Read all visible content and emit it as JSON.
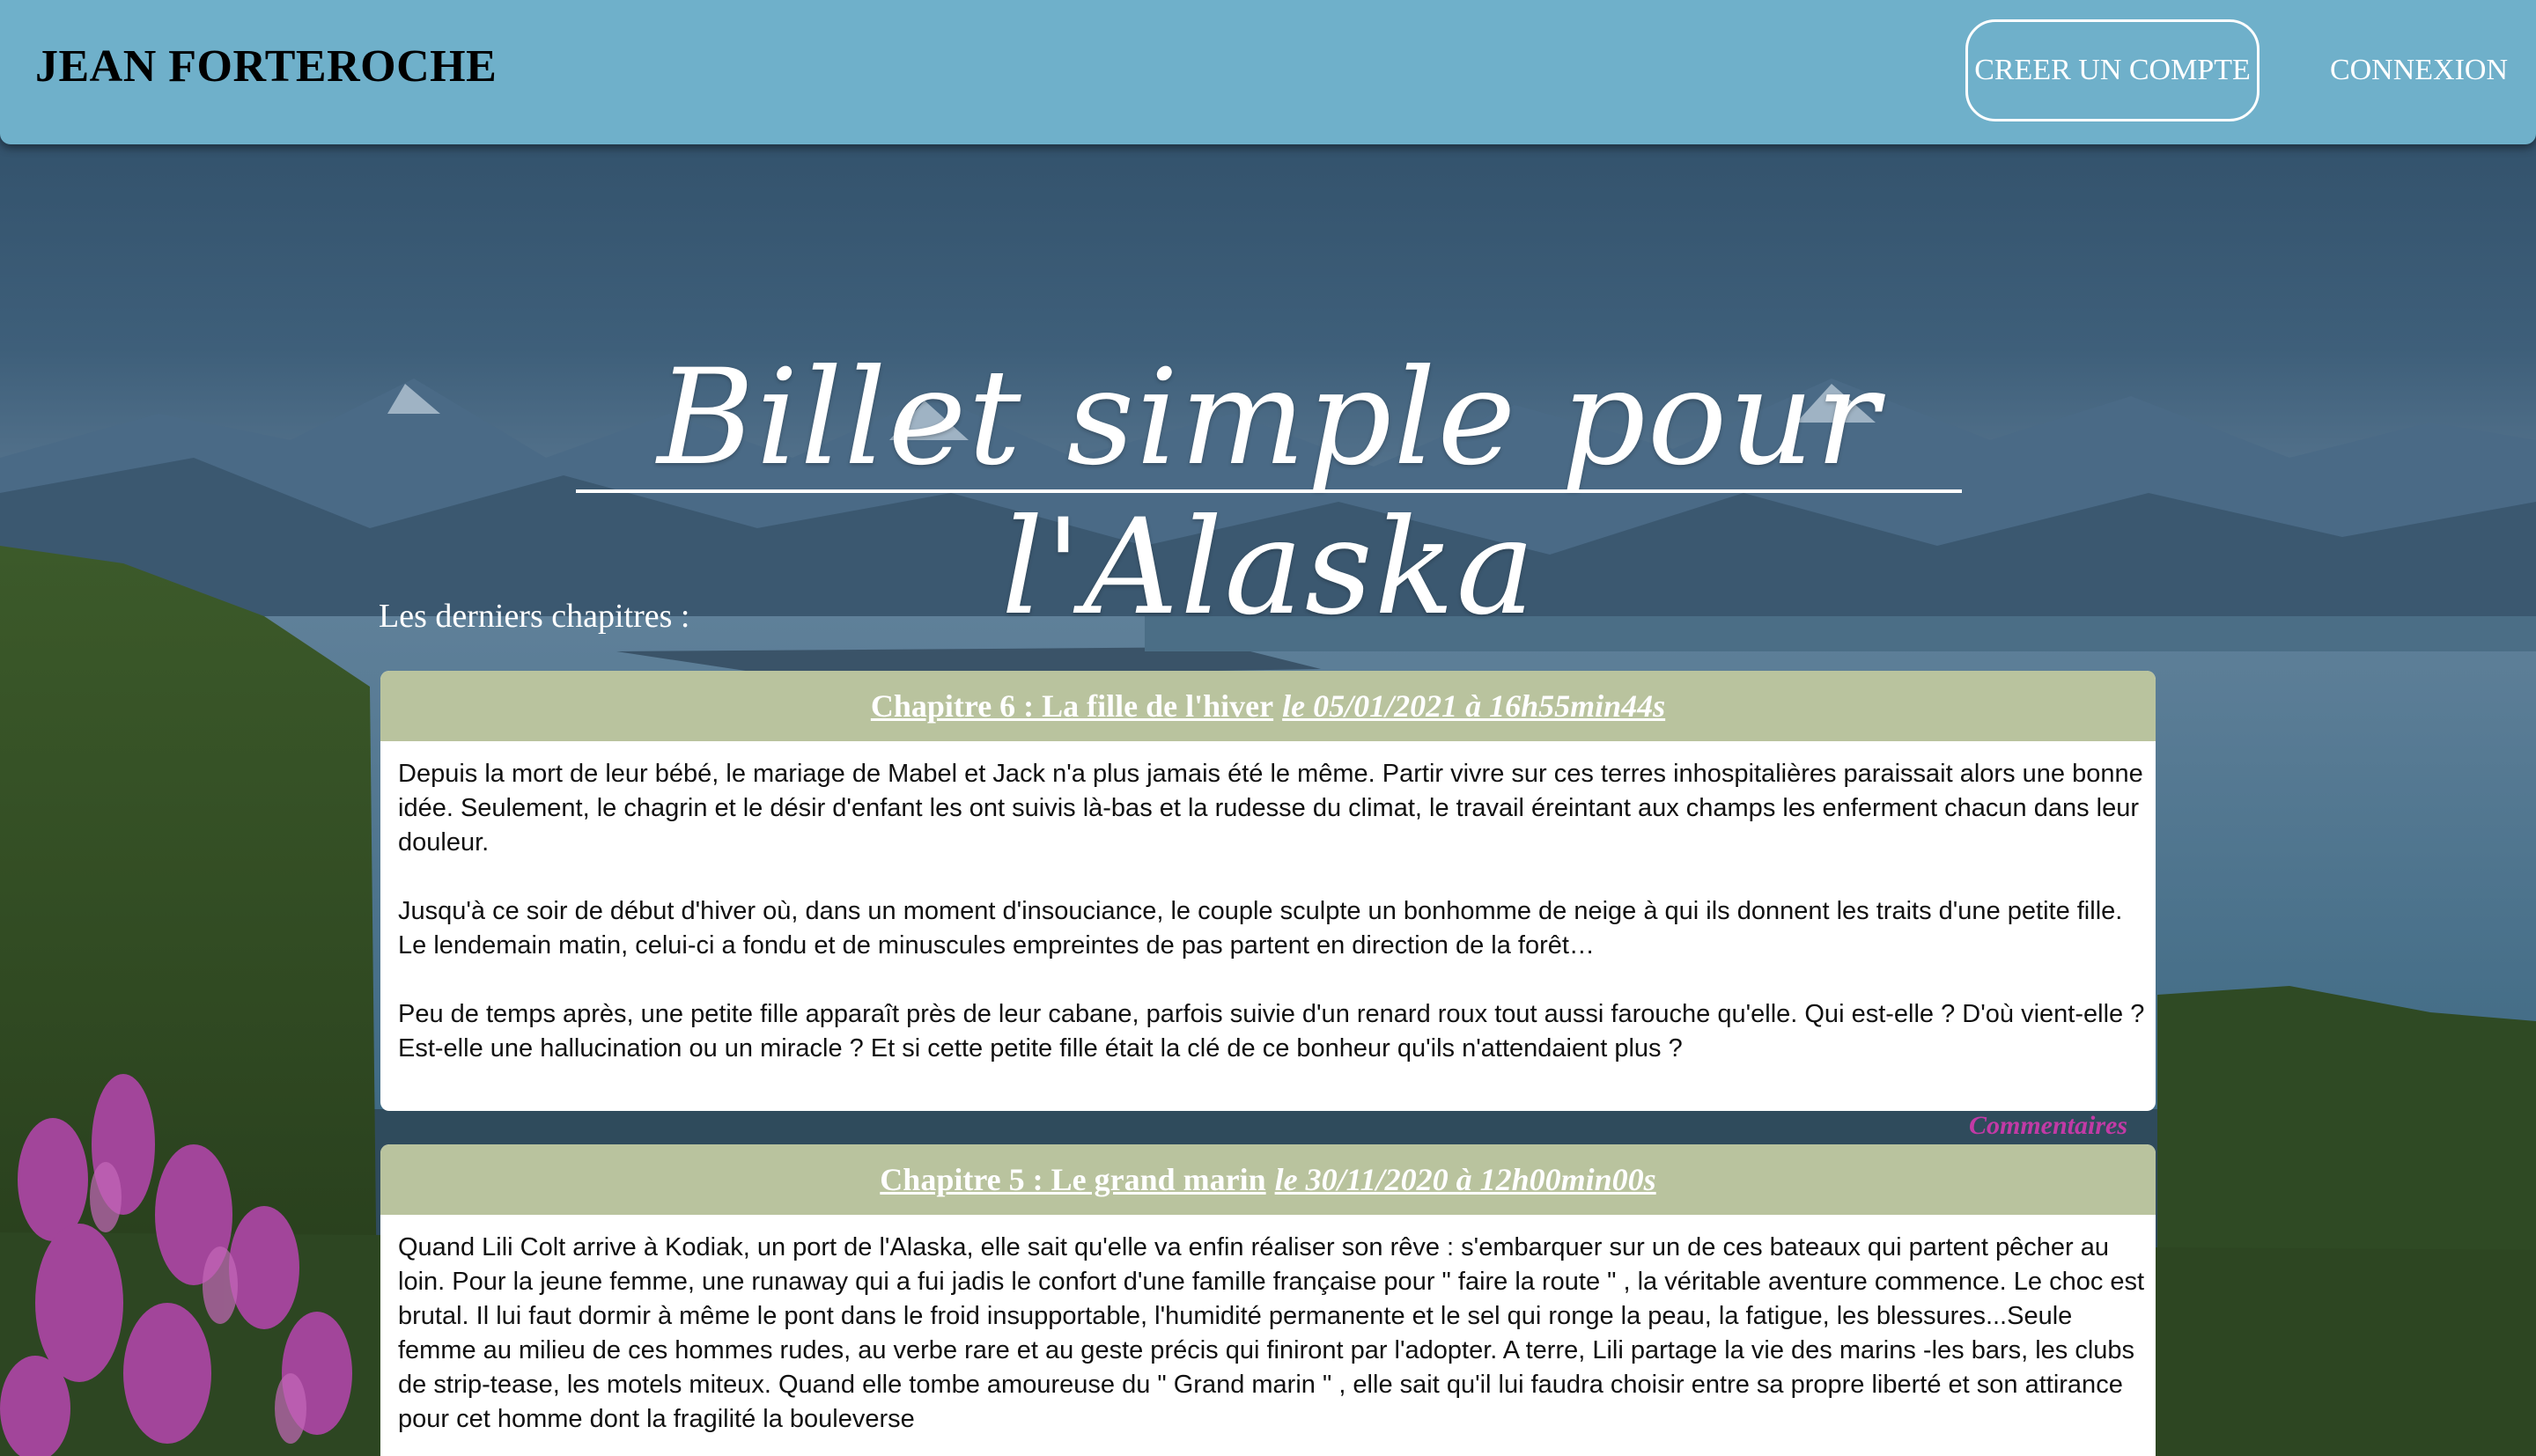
{
  "header": {
    "brand": "JEAN FORTEROCHE",
    "signup_label": "CREER UN COMPTE",
    "login_label": "CONNEXION"
  },
  "hero": {
    "title": "Billet simple pour l'Alaska"
  },
  "section": {
    "label": "Les derniers chapitres :"
  },
  "chapters": [
    {
      "title": "Chapitre 6 : La fille de l'hiver",
      "date": "le 05/01/2021 à 16h55min44s",
      "paragraphs": [
        "Depuis la mort de leur bébé, le mariage de Mabel et Jack n'a plus jamais été le même. Partir vivre sur ces terres inhospitalières paraissait alors une bonne idée. Seulement, le chagrin et le désir d'enfant les ont suivis là-bas et la rudesse du climat, le travail éreintant aux champs les enferment chacun dans leur douleur.",
        "Jusqu'à ce soir de début d'hiver où, dans un moment d'insouciance, le couple sculpte un bonhomme de neige à qui ils donnent les traits d'une petite fille. Le lendemain matin, celui-ci a fondu et de minuscules empreintes de pas partent en direction de la forêt…",
        "Peu de temps après, une petite fille apparaît près de leur cabane, parfois suivie d'un renard roux tout aussi farouche qu'elle. Qui est-elle ? D'où vient-elle ? Est-elle une hallucination ou un miracle ? Et si cette petite fille était la clé de ce bonheur qu'ils n'attendaient plus ?"
      ],
      "comments_label": "Commentaires"
    },
    {
      "title": "Chapitre 5 : Le grand marin",
      "date": "le 30/11/2020 à 12h00min00s",
      "paragraphs": [
        "Quand Lili Colt arrive à Kodiak, un port de l'Alaska, elle sait qu'elle va enfin réaliser son rêve : s'embarquer sur un de ces bateaux qui partent pêcher au loin. Pour la jeune femme, une runaway qui a fui jadis le confort d'une famille française pour \" faire la route \" , la véritable aventure commence. Le choc est brutal. Il lui faut dormir à même le pont dans le froid insupportable, l'humidité permanente et le sel qui ronge la peau, la fatigue, les blessures...Seule femme au milieu de ces hommes rudes, au verbe rare et au geste précis qui finiront par l'adopter. A terre, Lili partage la vie des marins -les bars, les clubs de strip-tease, les motels miteux. Quand elle tombe amoureuse du \" Grand marin \" , elle sait qu'il lui faudra choisir entre sa propre liberté et son attirance pour cet homme dont la fragilité la bouleverse"
      ]
    }
  ],
  "colors": {
    "header_bg": "#6fb0ca",
    "card_head_bg": "#b9c39e",
    "comments_link": "#c23aa6"
  }
}
